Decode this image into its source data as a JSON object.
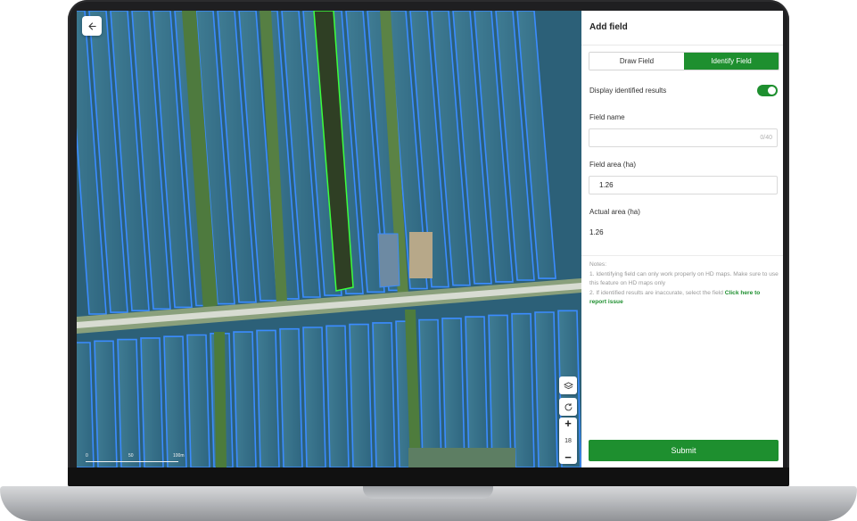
{
  "panel": {
    "title": "Add field",
    "tabs": [
      {
        "label": "Draw Field",
        "active": false
      },
      {
        "label": "Identify Field",
        "active": true
      }
    ],
    "display_results_label": "Display identified results",
    "display_results_enabled": true,
    "field_name": {
      "label": "Field name",
      "value": "",
      "counter": "0/40"
    },
    "field_area": {
      "label": "Field area (ha)",
      "value": "1.26"
    },
    "actual_area": {
      "label": "Actual area (ha)",
      "value": "1.26"
    },
    "notes": {
      "heading": "Notes:",
      "line1": "1. Identifying field can only work properly on HD maps. Make sure to use this feature on HD maps only",
      "line2_prefix": "2. If identified results are inaccurate, select the field",
      "line2_link": "Click here to report issue"
    },
    "submit_label": "Submit"
  },
  "map": {
    "zoom_level": "18",
    "scale_labels": [
      "0",
      "50",
      "100m"
    ],
    "icons": {
      "back": "arrow-left-icon",
      "layers": "layers-icon",
      "refresh": "refresh-icon",
      "zoom_in": "plus-icon",
      "zoom_out": "minus-icon"
    }
  },
  "colors": {
    "accent": "#1e8f2f",
    "field_outline": "#3b8cff",
    "selected_field_outline": "#3cff3c"
  }
}
